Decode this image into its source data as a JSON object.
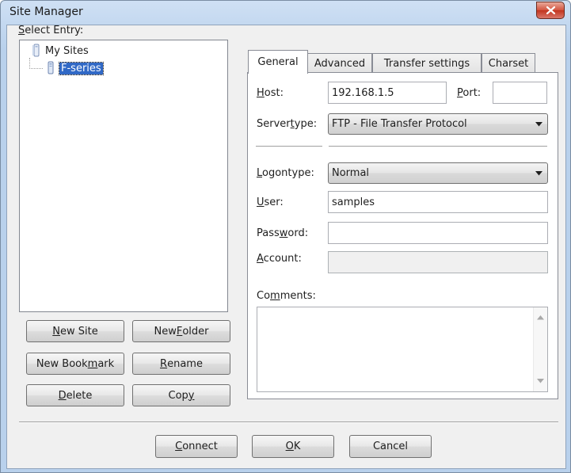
{
  "window": {
    "title": "Site Manager"
  },
  "left": {
    "select_entry_label": {
      "pre": "",
      "key": "S",
      "post": "elect Entry:"
    },
    "tree": {
      "root": "My Sites",
      "child": "F-series"
    },
    "buttons": {
      "new_site": {
        "pre": "",
        "key": "N",
        "post": "ew Site"
      },
      "new_folder": {
        "pre": "New ",
        "key": "F",
        "post": "older"
      },
      "new_bookmark": {
        "pre": "New Book",
        "key": "m",
        "post": "ark"
      },
      "rename": {
        "pre": "",
        "key": "R",
        "post": "ename"
      },
      "delete": {
        "pre": "",
        "key": "D",
        "post": "elete"
      },
      "copy": {
        "pre": "Cop",
        "key": "y",
        "post": ""
      }
    }
  },
  "tabs": [
    "General",
    "Advanced",
    "Transfer settings",
    "Charset"
  ],
  "general": {
    "host_label": {
      "pre": "",
      "key": "H",
      "post": "ost:"
    },
    "host_value": "192.168.1.5",
    "port_label": {
      "pre": "",
      "key": "P",
      "post": "ort:"
    },
    "port_value": "",
    "servertype_label": {
      "pre": "Server",
      "key": "t",
      "post": "ype:"
    },
    "servertype_value": "FTP - File Transfer Protocol",
    "logontype_label": {
      "pre": "",
      "key": "L",
      "post": "ogontype:"
    },
    "logontype_value": "Normal",
    "user_label": {
      "pre": "",
      "key": "U",
      "post": "ser:"
    },
    "user_value": "samples",
    "password_label": {
      "pre": "Pass",
      "key": "w",
      "post": "ord:"
    },
    "password_value": "",
    "account_label": {
      "pre": "",
      "key": "A",
      "post": "ccount:"
    },
    "account_value": "",
    "comments_label": {
      "pre": "Co",
      "key": "m",
      "post": "ments:"
    },
    "comments_value": ""
  },
  "footer": {
    "connect": {
      "pre": "",
      "key": "C",
      "post": "onnect"
    },
    "ok": {
      "pre": "",
      "key": "O",
      "post": "K"
    },
    "cancel": {
      "pre": "Cancel",
      "key": "",
      "post": ""
    }
  },
  "colors": {
    "selection": "#3169c6",
    "close_button": "#c2351f",
    "frame": "#b9d1ec"
  }
}
